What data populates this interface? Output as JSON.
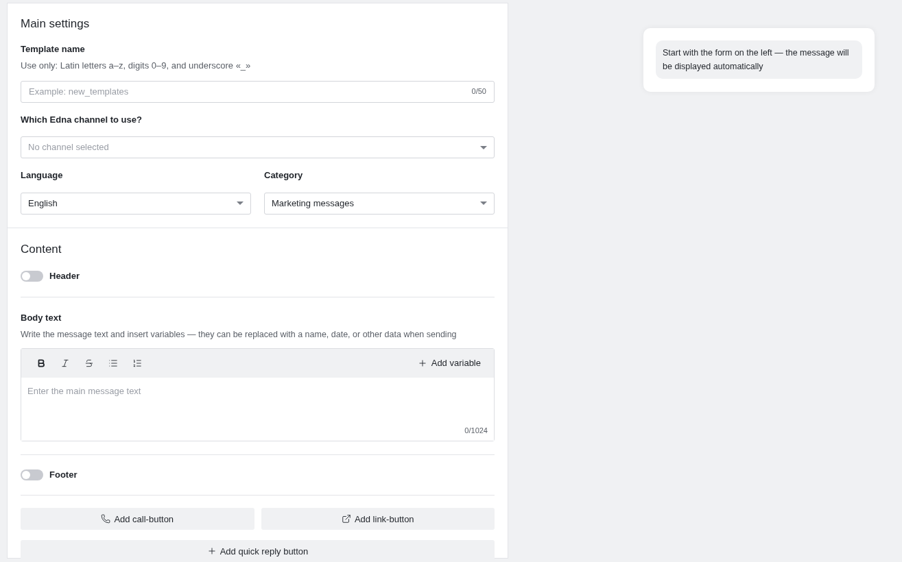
{
  "main_settings": {
    "title": "Main settings",
    "template_name": {
      "label": "Template name",
      "hint": "Use only: Latin letters a–z, digits 0–9, and underscore «_»",
      "placeholder": "Example: new_templates",
      "counter": "0/50"
    },
    "channel": {
      "label": "Which Edna channel to use?",
      "placeholder": "No channel selected"
    },
    "language": {
      "label": "Language",
      "value": "English"
    },
    "category": {
      "label": "Category",
      "value": "Marketing messages"
    }
  },
  "content": {
    "title": "Content",
    "header": {
      "label": "Header",
      "on": false
    },
    "body": {
      "label": "Body text",
      "hint": "Write the message text and insert variables — they can be replaced with a name, date, or other data when sending",
      "toolbar": [
        {
          "kind": "bold"
        },
        {
          "kind": "italic"
        },
        {
          "kind": "strike"
        },
        {
          "kind": "bullets"
        },
        {
          "kind": "numbered"
        }
      ],
      "add_variable": "Add variable",
      "placeholder": "Enter the main message text",
      "counter": "0/1024"
    },
    "footer": {
      "label": "Footer",
      "on": false
    },
    "buttons": [
      {
        "kind": "call",
        "label": "Add call-button"
      },
      {
        "kind": "link",
        "label": "Add link-button"
      },
      {
        "kind": "quick",
        "label": "Add quick reply button"
      }
    ]
  },
  "preview": {
    "text": "Start with the form on the left — the message will be displayed automatically"
  }
}
